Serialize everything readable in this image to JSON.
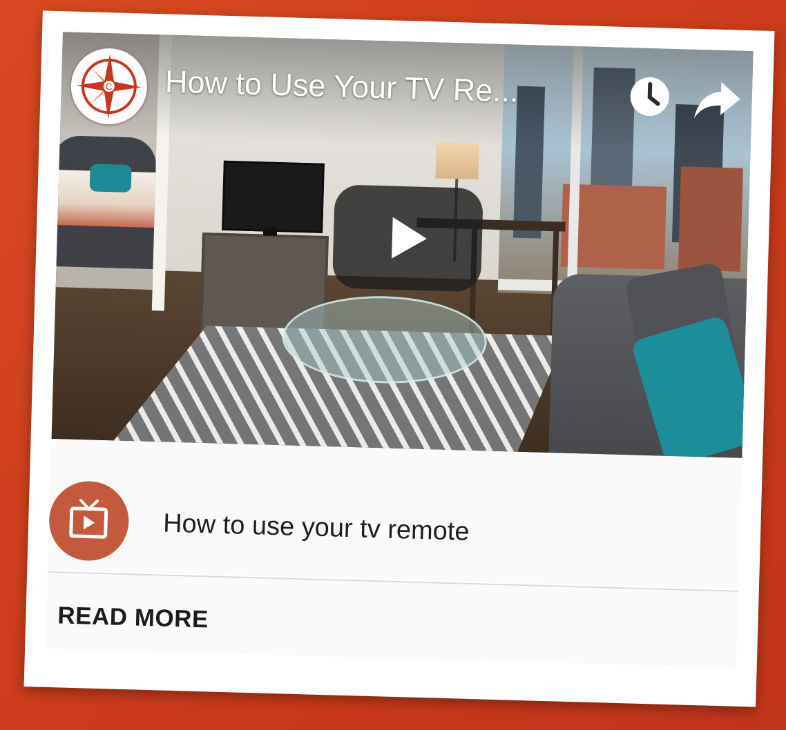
{
  "video": {
    "title": "How to Use Your TV Re...",
    "channel_logo_letter": "C"
  },
  "post": {
    "title": "How to use your tv remote"
  },
  "footer": {
    "read_more_label": "READ MORE"
  },
  "colors": {
    "background": "#d3431f",
    "channel_icon": "#c25a3b",
    "logo_red": "#c8341e"
  }
}
